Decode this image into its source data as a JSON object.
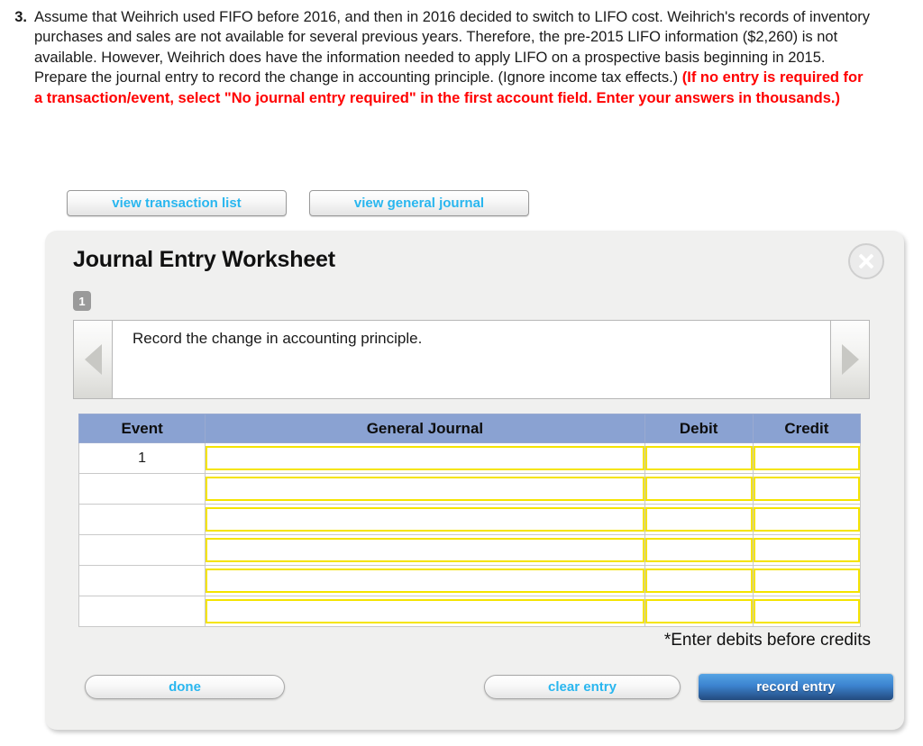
{
  "question": {
    "number": "3.",
    "text_part1": "Assume that Weihrich used FIFO before 2016, and then in 2016 decided to switch to LIFO cost. Weihrich's records of inventory purchases and sales are not available for several previous years. Therefore, the pre-2015 LIFO information ($2,260) is not available. However, Weihrich does have the information needed to apply LIFO on a prospective basis beginning in 2015. Prepare the journal entry to record the change in accounting principle. (Ignore income tax effects.) ",
    "text_emphasis": "(If no entry is required for a transaction/event, select \"No journal entry required\" in the first account field. Enter your answers in thousands.)"
  },
  "view_buttons": {
    "transaction_list": "view transaction list",
    "general_journal": "view general journal"
  },
  "worksheet": {
    "title": "Journal Entry Worksheet",
    "close_icon": "close-icon",
    "step_badge": "1",
    "prev_icon": "chevron-left-icon",
    "next_icon": "chevron-right-icon",
    "description": "Record the change in accounting principle.",
    "note": "*Enter debits before credits",
    "columns": [
      "Event",
      "General Journal",
      "Debit",
      "Credit"
    ],
    "rows": [
      {
        "event": "1",
        "general_journal": "",
        "debit": "",
        "credit": ""
      },
      {
        "event": "",
        "general_journal": "",
        "debit": "",
        "credit": ""
      },
      {
        "event": "",
        "general_journal": "",
        "debit": "",
        "credit": ""
      },
      {
        "event": "",
        "general_journal": "",
        "debit": "",
        "credit": ""
      },
      {
        "event": "",
        "general_journal": "",
        "debit": "",
        "credit": ""
      },
      {
        "event": "",
        "general_journal": "",
        "debit": "",
        "credit": ""
      }
    ],
    "actions": {
      "done": "done",
      "clear_entry": "clear entry",
      "record_entry": "record entry"
    }
  },
  "colors": {
    "header_blue": "#8aa2d2",
    "link_cyan": "#29b6ef",
    "emphasis_red": "#ff0000",
    "input_yellow": "#f5e400",
    "record_blue": "#3c83cf",
    "panel_gray": "#f0f0ef"
  }
}
